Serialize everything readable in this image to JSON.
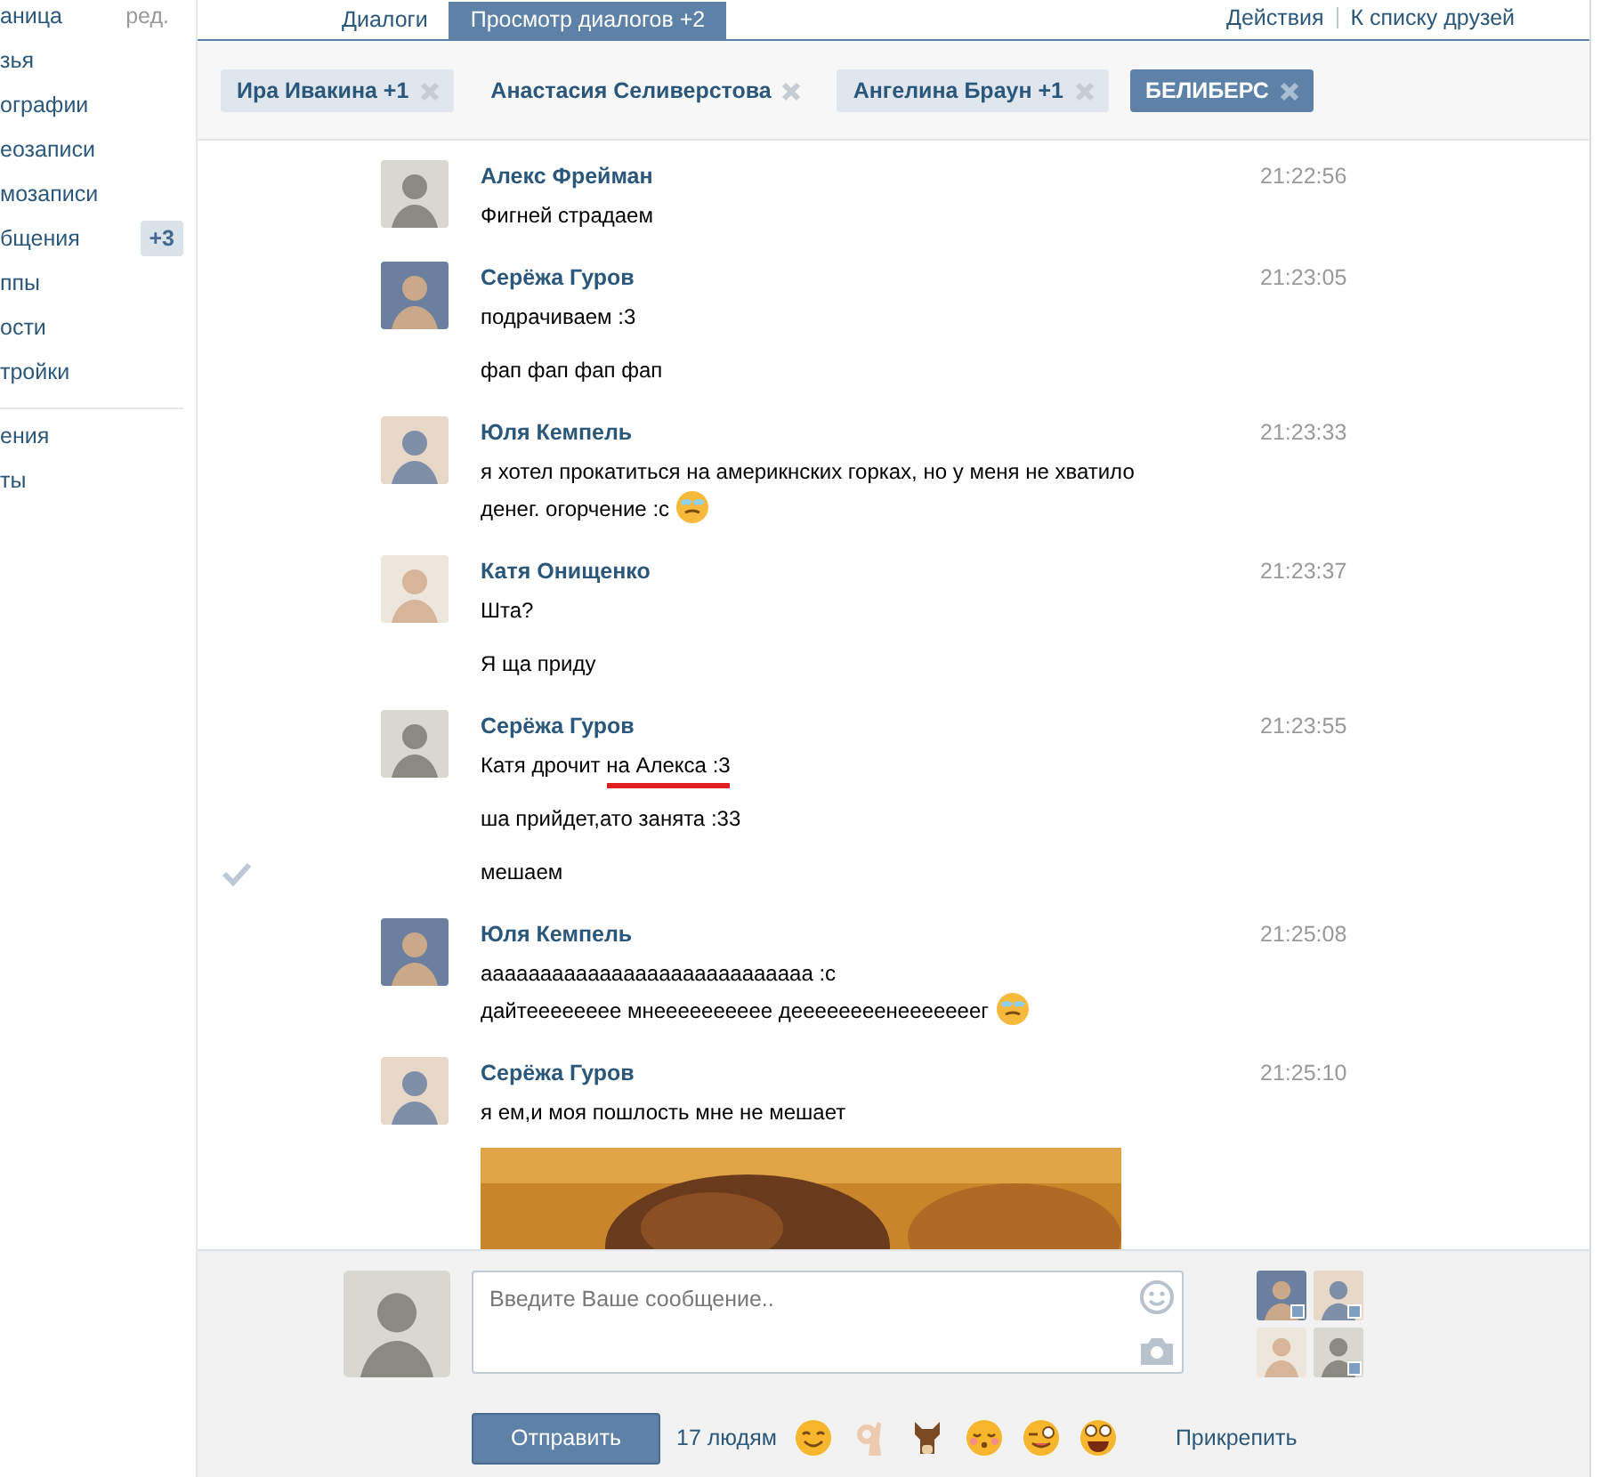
{
  "sidebar": {
    "items": [
      {
        "label": "аница",
        "extra": "ред."
      },
      {
        "label": "зья"
      },
      {
        "label": "ографии"
      },
      {
        "label": "еозаписи"
      },
      {
        "label": "мозаписи"
      },
      {
        "label": "бщения",
        "badge": "+3"
      },
      {
        "label": "ппы"
      },
      {
        "label": "ости"
      },
      {
        "label": "тройки"
      }
    ],
    "secondary_items": [
      {
        "label": "ения"
      },
      {
        "label": "ты"
      }
    ]
  },
  "tabs": [
    {
      "label": "Диалоги",
      "selected": false
    },
    {
      "label": "Просмотр диалогов +2",
      "selected": true
    }
  ],
  "actions": [
    "Действия",
    "К списку друзей"
  ],
  "chips": [
    {
      "label": "Ира Ивакина +1",
      "unread": true,
      "selected": false
    },
    {
      "label": "Анастасия Селиверстова",
      "unread": false,
      "selected": false
    },
    {
      "label": "Ангелина Браун +1",
      "unread": true,
      "selected": false
    },
    {
      "label": "БЕЛИБЕРС",
      "unread": false,
      "selected": true
    }
  ],
  "messages": [
    {
      "author": "Алекс Фрейман",
      "time": "21:22:56",
      "lines": [
        {
          "text": "Фигней страдаем",
          "emoji": false,
          "read_mark": false
        }
      ]
    },
    {
      "author": "Серёжа Гуров",
      "time": "21:23:05",
      "lines": [
        {
          "text": "подрачиваем :3",
          "emoji": false,
          "read_mark": false
        },
        {
          "text": "фап фап фап фап",
          "emoji": false,
          "read_mark": false
        }
      ]
    },
    {
      "author": "Юля Кемпель",
      "time": "21:23:33",
      "lines": [
        {
          "text": "я хотел прокатиться на америкнских горках, но у меня не хватило денег. огорчение :с",
          "emoji": true,
          "read_mark": false
        }
      ]
    },
    {
      "author": "Катя Онищенко",
      "time": "21:23:37",
      "lines": [
        {
          "text": "Шта?",
          "emoji": false,
          "read_mark": false
        },
        {
          "text": "Я ща приду",
          "emoji": false,
          "read_mark": false
        }
      ]
    },
    {
      "author": "Серёжа Гуров",
      "time": "21:23:55",
      "lines": [
        {
          "text": "Катя дрочит ",
          "underlined": "на Алекса :3",
          "emoji": false,
          "read_mark": false
        },
        {
          "text": "ша прийдет,ато занята :33",
          "emoji": false,
          "read_mark": false
        },
        {
          "text": "мешаем",
          "emoji": false,
          "read_mark": true
        }
      ]
    },
    {
      "author": "Юля Кемпель",
      "time": "21:25:08",
      "lines": [
        {
          "text": "аааааааааааааааааааааааааааа :с\nдайтееееееее мнееееееееее деееееееенееееееег",
          "emoji": true,
          "read_mark": false
        }
      ]
    },
    {
      "author": "Серёжа Гуров",
      "time": "21:25:10",
      "lines": [
        {
          "text": "я ем,и моя пошлость мне не мешает",
          "emoji": false,
          "read_mark": false
        },
        {
          "kind": "picture"
        }
      ]
    }
  ],
  "composer": {
    "placeholder": "Введите Ваше сообщение..",
    "send": "Отправить",
    "recipients": "17 людям",
    "attach": "Прикрепить"
  },
  "recent_contacts": [
    {
      "online": true
    },
    {
      "online": true
    },
    {
      "online": false
    },
    {
      "online": true
    }
  ]
}
